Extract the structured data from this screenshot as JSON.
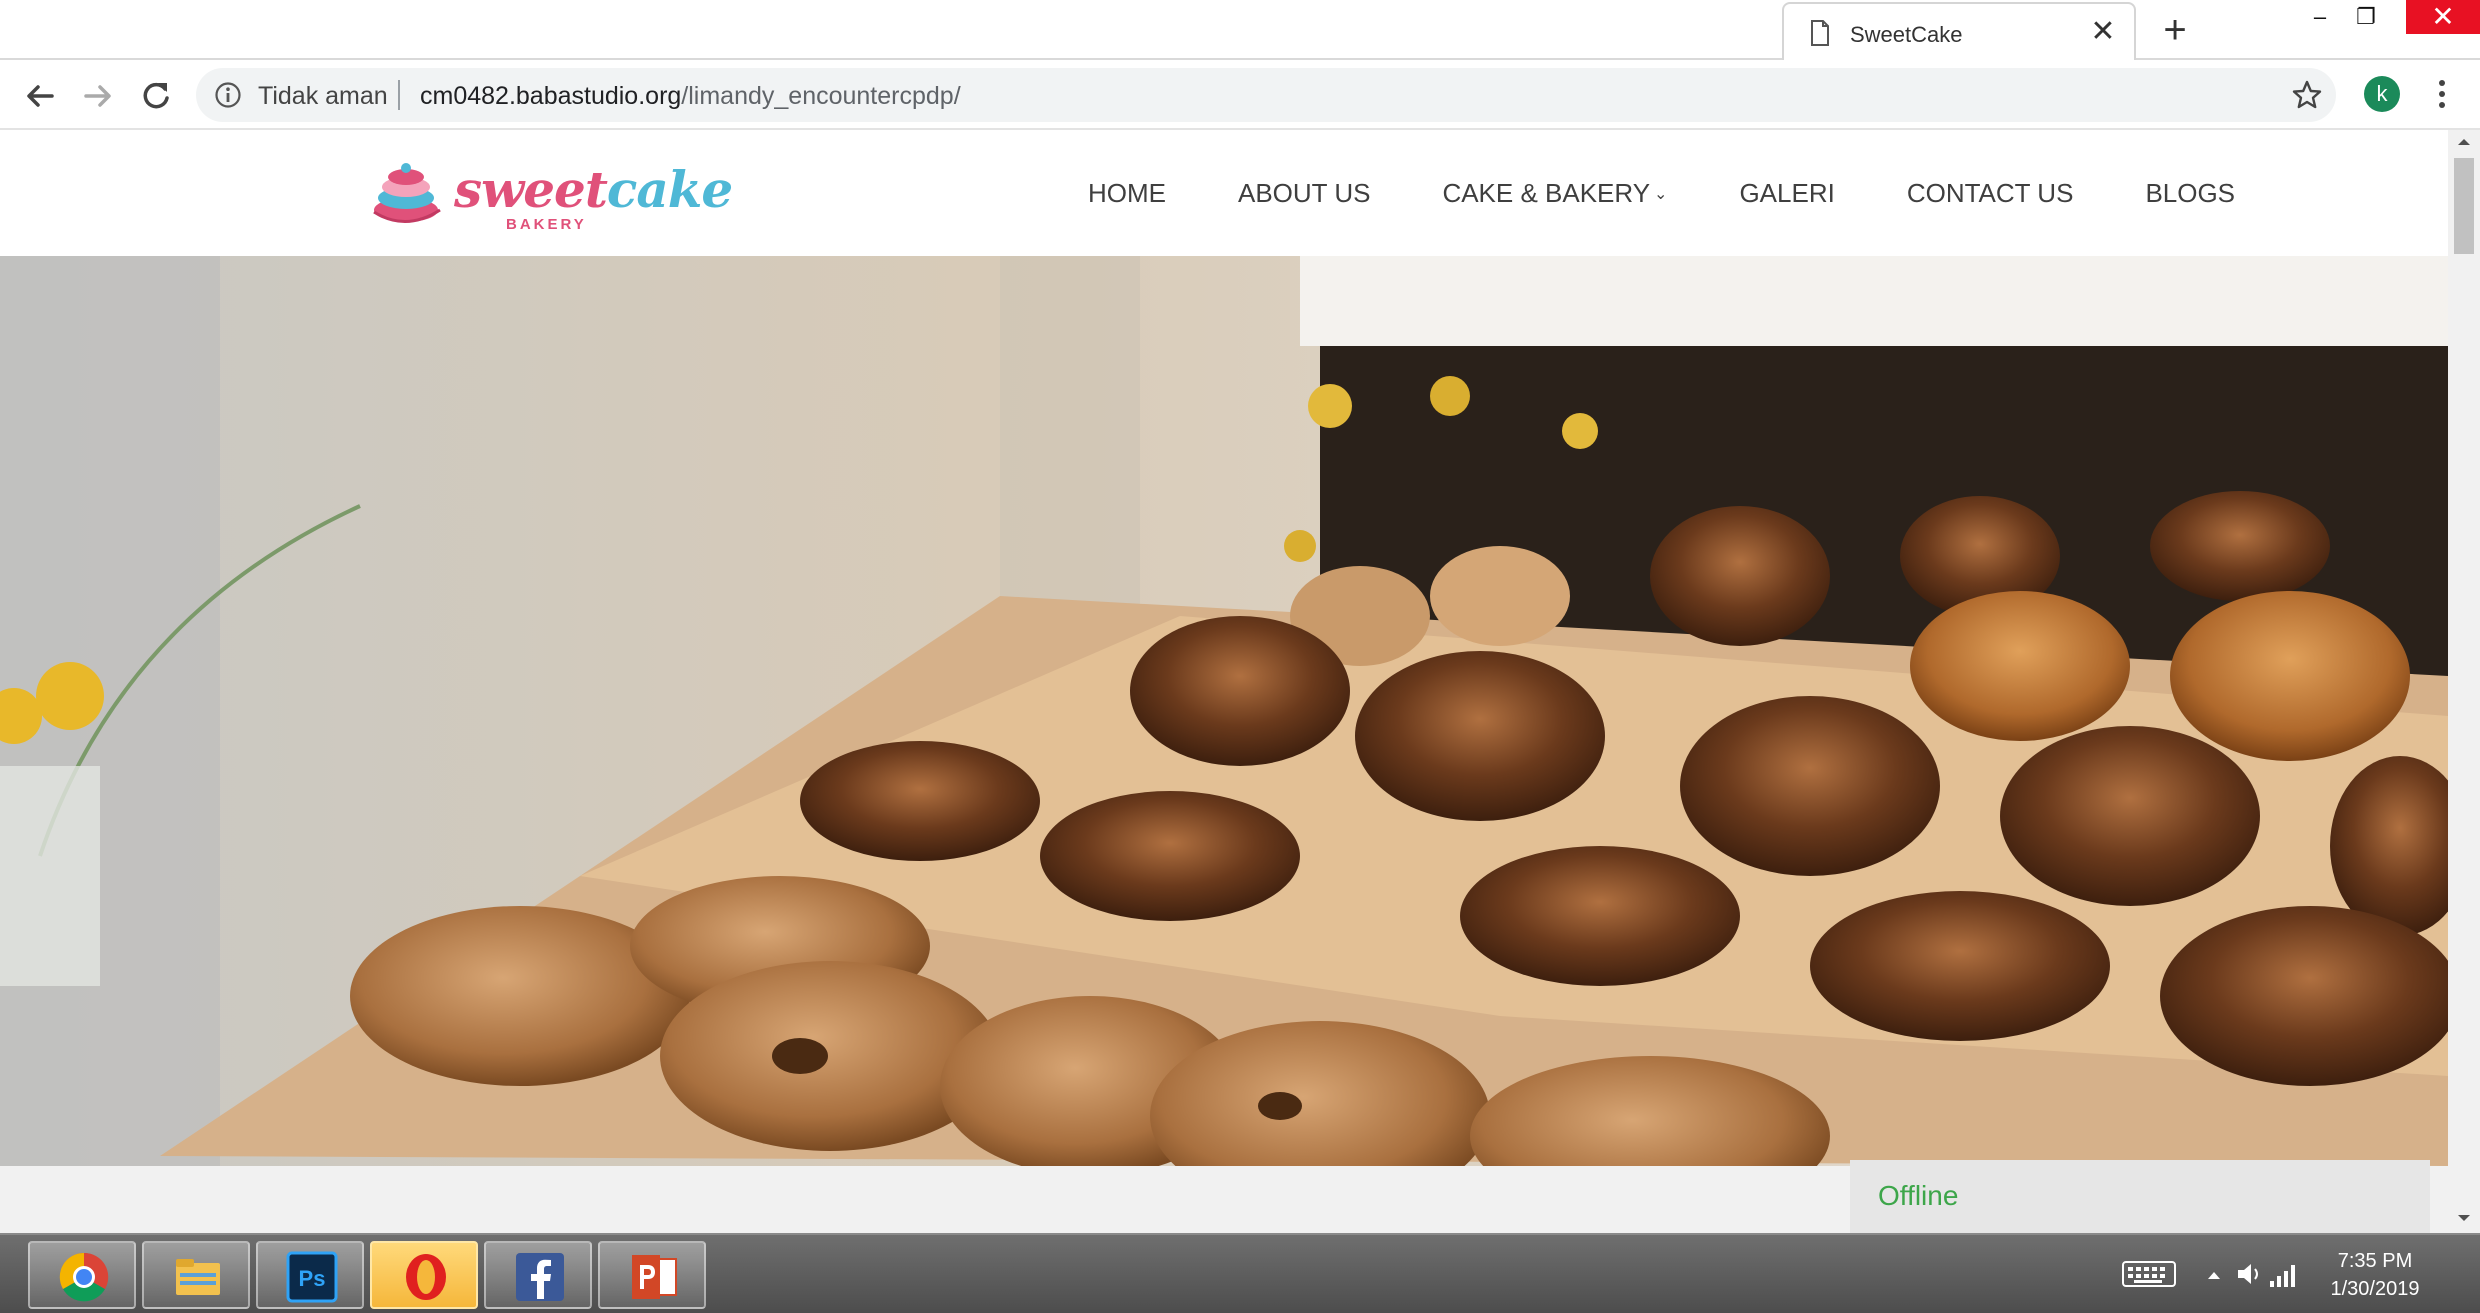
{
  "browser": {
    "tab": {
      "title": "SweetCake",
      "close_glyph": "✕"
    },
    "new_tab_glyph": "+",
    "window_buttons": {
      "minimize": "–",
      "restore": "❐",
      "close": "✕"
    },
    "security_label": "Tidak aman",
    "url": {
      "host": "cm0482.babastudio.org",
      "path": "/limandy_encountercpdp/"
    },
    "profile_initial": "k"
  },
  "site": {
    "logo": {
      "word_sweet": "sweet",
      "word_cake": "cake",
      "sub": "BAKERY"
    },
    "nav": [
      {
        "label": "HOME"
      },
      {
        "label": "ABOUT US"
      },
      {
        "label": "CAKE & BAKERY",
        "has_dropdown": true
      },
      {
        "label": "GALERI"
      },
      {
        "label": "CONTACT US"
      },
      {
        "label": "BLOGS"
      }
    ],
    "hero_alt_icon": "bakery-pastries-photo",
    "offline_label": "Offline"
  },
  "taskbar": {
    "apps": [
      "chrome-icon",
      "file-explorer-icon",
      "photoshop-icon",
      "opera-icon",
      "facebook-icon",
      "powerpoint-icon"
    ],
    "photoshop_label": "Ps",
    "clock": {
      "time": "7:35 PM",
      "date": "1/30/2019"
    }
  },
  "colors": {
    "brand_pink": "#e0517a",
    "brand_blue": "#4fb8d6",
    "offline_green": "#3da64a"
  }
}
